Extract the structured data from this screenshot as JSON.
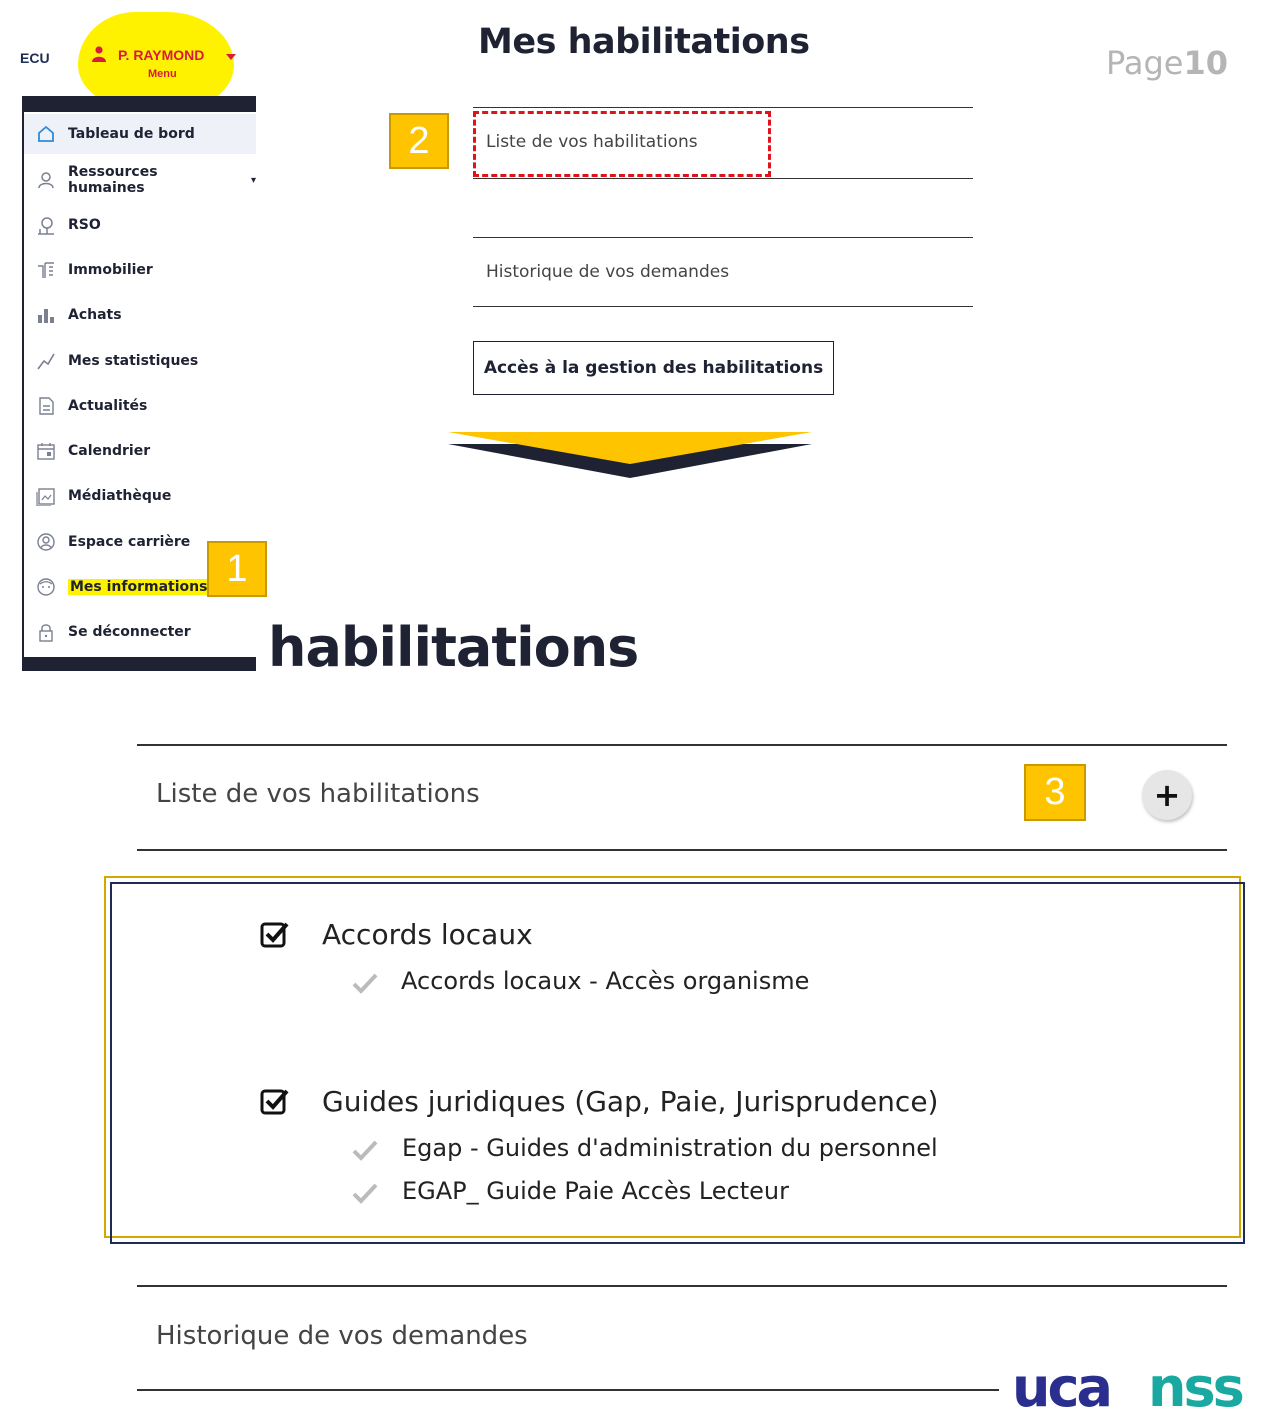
{
  "top_left": {
    "fragment": "ECU",
    "user_name": "P. RAYMOND",
    "user_menu_label": "Menu"
  },
  "sidebar": {
    "items": [
      {
        "label": "Tableau de bord",
        "icon": "home-icon"
      },
      {
        "label": "Ressources humaines",
        "icon": "user-icon"
      },
      {
        "label": "RSO",
        "icon": "tree-icon"
      },
      {
        "label": "Immobilier",
        "icon": "building-icon"
      },
      {
        "label": "Achats",
        "icon": "chart-bars-icon"
      },
      {
        "label": "Mes statistiques",
        "icon": "stats-icon"
      },
      {
        "label": "Actualités",
        "icon": "document-icon"
      },
      {
        "label": "Calendrier",
        "icon": "calendar-icon"
      },
      {
        "label": "Médiathèque",
        "icon": "image-icon"
      },
      {
        "label": "Espace carrière",
        "icon": "profile-circle-icon"
      },
      {
        "label": "Mes informations",
        "icon": "face-icon"
      },
      {
        "label": "Se déconnecter",
        "icon": "lock-icon"
      }
    ]
  },
  "annotations": {
    "step1": "1",
    "step2": "2",
    "step3": "3"
  },
  "top_panel": {
    "title": "Mes habilitations",
    "page_label": "Page",
    "page_number": "10",
    "row1": "Liste de vos habilitations",
    "row2": "Historique de vos demandes",
    "access_button": "Accès à la gestion des habilitations"
  },
  "zoom_panel": {
    "title_fragment": "habilitations",
    "row1": "Liste de vos habilitations",
    "expand_button": "+",
    "groups": [
      {
        "title": "Accords locaux",
        "items": [
          "Accords locaux - Accès organisme"
        ]
      },
      {
        "title": "Guides juridiques (Gap, Paie, Jurisprudence)",
        "items": [
          "Egap - Guides d'administration du personnel",
          "EGAP_ Guide Paie Accès Lecteur"
        ]
      }
    ],
    "row2": "Historique de vos demandes"
  },
  "logo": {
    "text": "ucanss"
  },
  "colors": {
    "navy": "#1e2233",
    "highlight": "#fff200",
    "annotation": "#ffc400",
    "accent_red": "#d81a3e",
    "logo_blue": "#2a2f8f",
    "logo_teal": "#1aa9a0"
  }
}
